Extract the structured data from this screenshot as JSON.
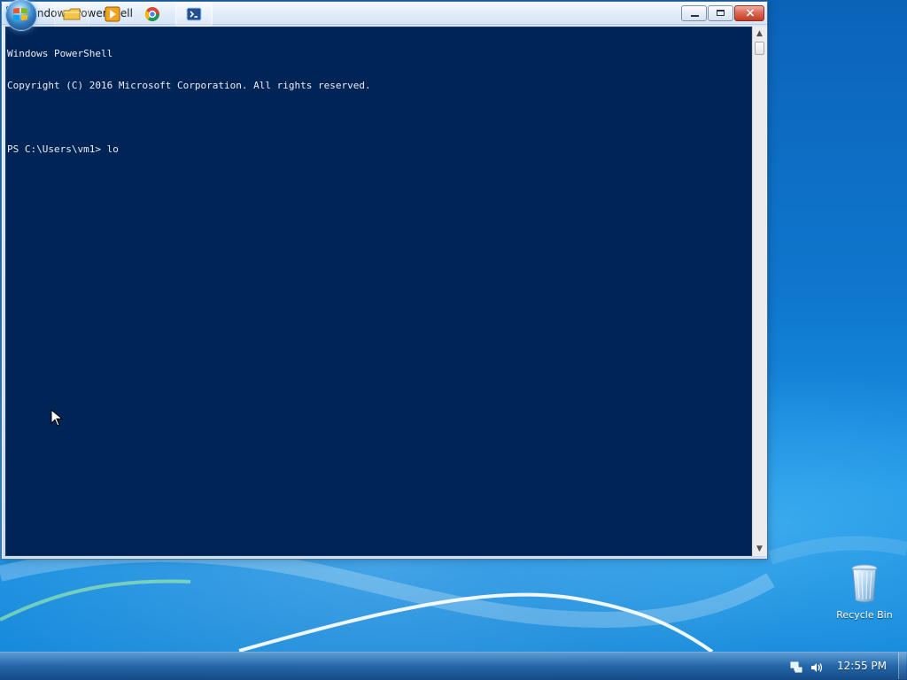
{
  "window": {
    "title": "Windows PowerShell"
  },
  "console": {
    "lines": [
      "Windows PowerShell",
      "Copyright (C) 2016 Microsoft Corporation. All rights reserved.",
      "",
      "PS C:\\Users\\vm1> lo"
    ],
    "background": "#012456",
    "foreground": "#eeedf0"
  },
  "desktop": {
    "recycle_bin_label": "Recycle Bin"
  },
  "taskbar": {
    "clock": "12:55 PM",
    "pinned": [
      {
        "name": "file-explorer",
        "icon": "folder-icon"
      },
      {
        "name": "media-player",
        "icon": "media-player-icon"
      },
      {
        "name": "chrome",
        "icon": "chrome-icon"
      },
      {
        "name": "powershell",
        "icon": "powershell-icon"
      }
    ]
  },
  "colors": {
    "accent": "#2e79bf",
    "close_button": "#c73b24"
  }
}
